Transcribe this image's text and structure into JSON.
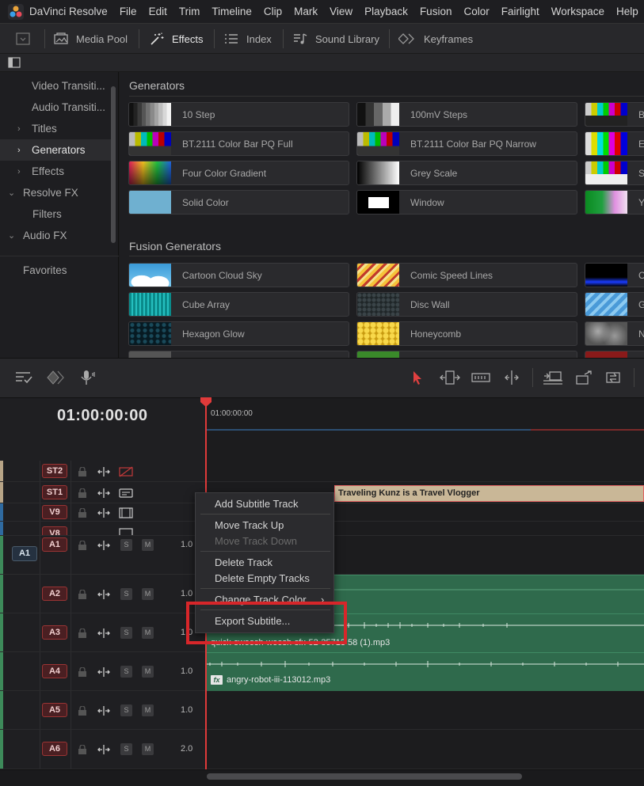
{
  "app": {
    "name": "DaVinci Resolve"
  },
  "menubar": {
    "items": [
      "File",
      "Edit",
      "Trim",
      "Timeline",
      "Clip",
      "Mark",
      "View",
      "Playback",
      "Fusion",
      "Color",
      "Fairlight",
      "Workspace",
      "Help"
    ]
  },
  "toolbar": {
    "media_pool": "Media Pool",
    "effects": "Effects",
    "index": "Index",
    "sound_library": "Sound Library",
    "keyframes": "Keyframes"
  },
  "left_panel": {
    "items": [
      "Video Transiti...",
      "Audio Transiti...",
      "Titles",
      "Generators",
      "Effects",
      "Resolve FX",
      "Filters",
      "Audio FX"
    ],
    "selected": "Generators",
    "favorites": "Favorites"
  },
  "generators": {
    "title": "Generators",
    "tiles": [
      "10 Step",
      "100mV Steps",
      "B",
      "BT.2111 Color Bar PQ Full",
      "BT.2111 Color Bar PQ Narrow",
      "E",
      "Four Color Gradient",
      "Grey Scale",
      "S",
      "Solid Color",
      "Window",
      "Y"
    ]
  },
  "fusion_generators": {
    "title": "Fusion Generators",
    "tiles": [
      "Cartoon Cloud Sky",
      "Comic Speed Lines",
      "C",
      "Cube Array",
      "Disc Wall",
      "G",
      "Hexagon Glow",
      "Honeycomb",
      "N"
    ]
  },
  "timeline": {
    "timecode": "01:00:00:00",
    "ruler_timecode": "01:00:00:00",
    "tracks": {
      "st2": "ST2",
      "st1": "ST1",
      "v9": "V9",
      "v8": "V8",
      "a1": "A1",
      "a2": "A2",
      "a3": "A3",
      "a4": "A4",
      "a5": "A5",
      "a6": "A6"
    },
    "source_a1": "A1",
    "volumes": {
      "a1": "1.0",
      "a2": "1.0",
      "a3": "1.0",
      "a4": "1.0",
      "a5": "1.0",
      "a6": "2.0"
    },
    "solo": "S",
    "mute": "M",
    "subtitle_clip": "Traveling Kunz is a Travel Vlogger",
    "a3_clip": "quick-swoosh-woosh-sfx-52-35713 58 (1).mp3",
    "a4_clip": "angry-robot-iii-113012.mp3",
    "fx_badge": "fx"
  },
  "context_menu": {
    "add_subtitle_track": "Add Subtitle Track",
    "move_track_up": "Move Track Up",
    "move_track_down": "Move Track Down",
    "delete_track": "Delete Track",
    "delete_empty_tracks": "Delete Empty Tracks",
    "change_track_color": "Change Track Color",
    "submenu_arrow": "›",
    "export_subtitle": "Export Subtitle..."
  },
  "colors": {
    "accent_red": "#d7262a",
    "playhead": "#e03a3a",
    "audio_clip": "#2f6a4c",
    "subtitle_clip": "#c9b797"
  }
}
